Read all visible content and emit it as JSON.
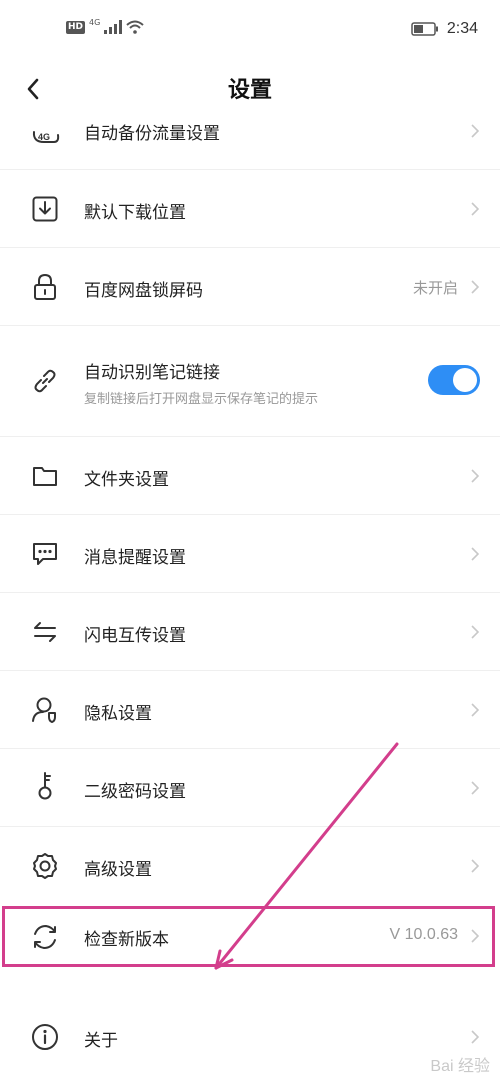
{
  "status_bar": {
    "hd": "HD",
    "network": "4G",
    "time": "2:34"
  },
  "nav": {
    "title": "设置"
  },
  "rows": [
    {
      "id": "backup",
      "label": "自动备份流量设置",
      "icon": "4g-cloud-icon"
    },
    {
      "id": "download",
      "label": "默认下载位置",
      "icon": "download-box-icon"
    },
    {
      "id": "lock",
      "label": "百度网盘锁屏码",
      "value": "未开启",
      "icon": "lock-icon"
    },
    {
      "id": "notes",
      "label": "自动识别笔记链接",
      "sub": "复制链接后打开网盘显示保存笔记的提示",
      "toggle": true,
      "icon": "link-icon"
    },
    {
      "id": "folder",
      "label": "文件夹设置",
      "icon": "folder-icon"
    },
    {
      "id": "message",
      "label": "消息提醒设置",
      "icon": "message-icon"
    },
    {
      "id": "transfer",
      "label": "闪电互传设置",
      "icon": "transfer-arrows-icon"
    },
    {
      "id": "privacy",
      "label": "隐私设置",
      "icon": "privacy-user-icon"
    },
    {
      "id": "password",
      "label": "二级密码设置",
      "icon": "key-icon"
    },
    {
      "id": "advanced",
      "label": "高级设置",
      "icon": "gear-icon"
    },
    {
      "id": "update",
      "label": "检查新版本",
      "value": "V 10.0.63",
      "icon": "refresh-icon"
    },
    {
      "id": "about",
      "label": "关于",
      "icon": "info-icon"
    }
  ],
  "watermark": {
    "text": "Bai  经验"
  },
  "colors": {
    "accent": "#2e8ef5",
    "highlight": "#d33e8c"
  }
}
